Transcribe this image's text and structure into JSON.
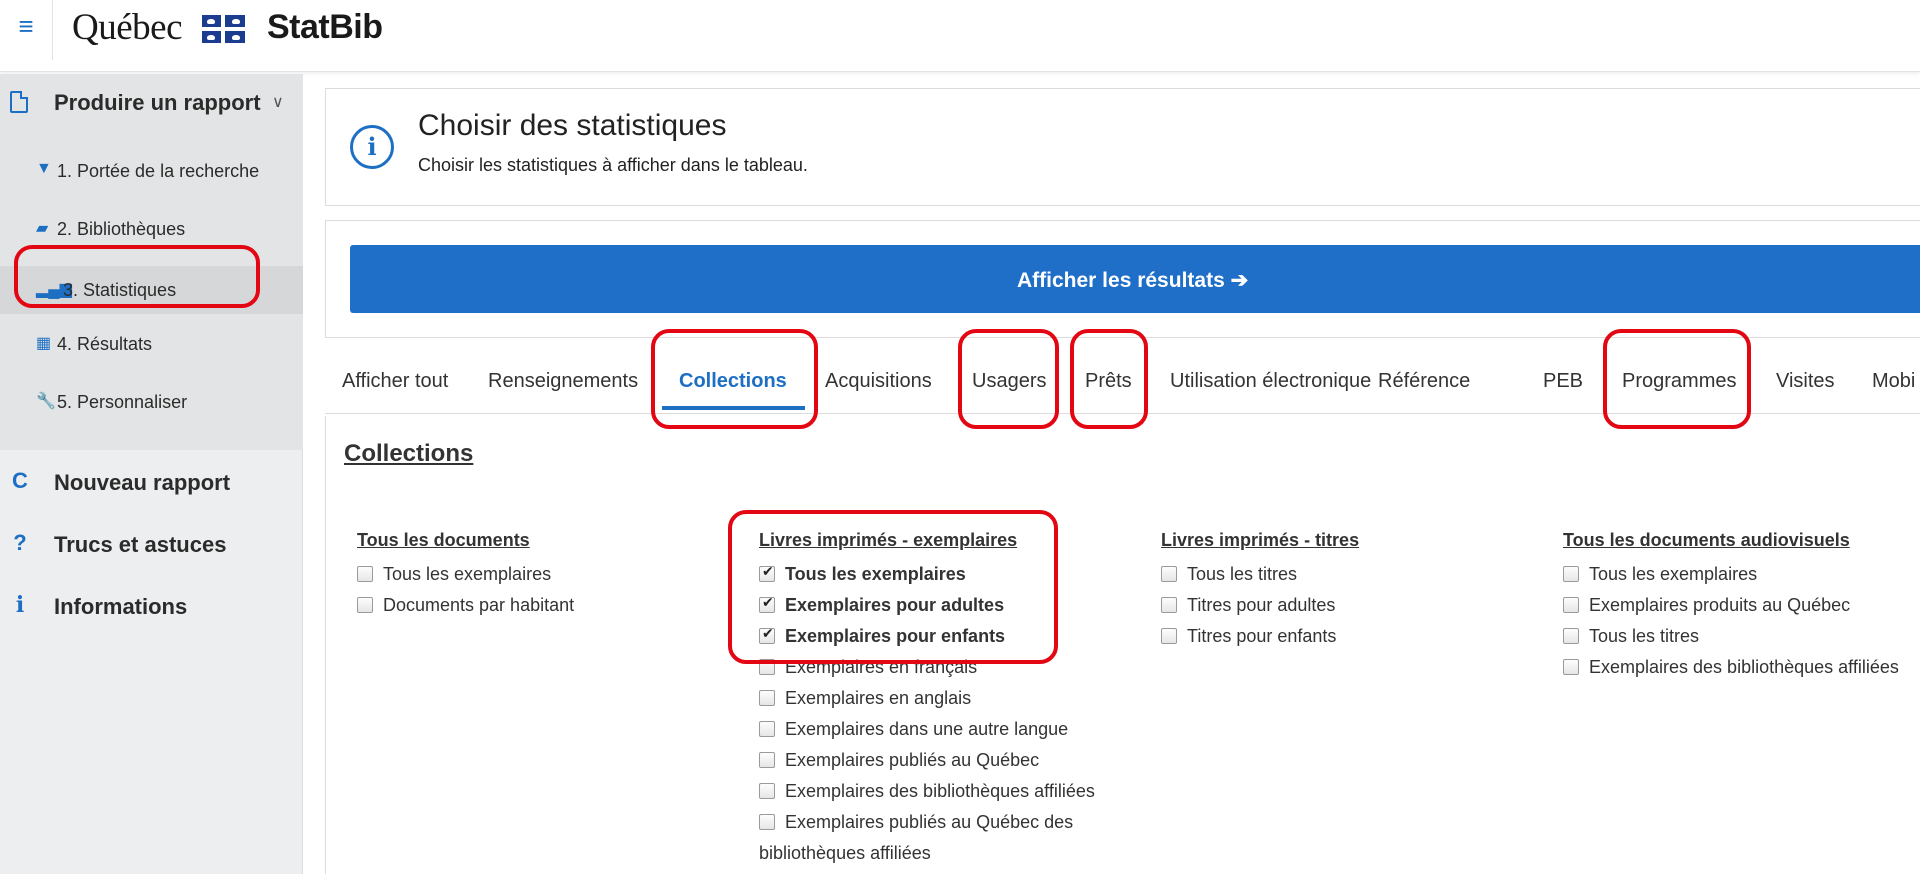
{
  "header": {
    "menu_icon": "hamburger-icon",
    "brand_quebec": "Québec",
    "brand_app": "StatBib"
  },
  "sidebar": {
    "section_label": "Produire un rapport",
    "steps": [
      {
        "label": "1. Portée de la recherche",
        "icon": "filter-icon"
      },
      {
        "label": "2. Bibliothèques",
        "icon": "book-icon"
      },
      {
        "label": "3. Statistiques",
        "icon": "bar-chart-icon"
      },
      {
        "label": "4. Résultats",
        "icon": "table-icon"
      },
      {
        "label": "5. Personnaliser",
        "icon": "wrench-icon"
      }
    ],
    "menu": [
      {
        "label": "Nouveau rapport",
        "icon": "refresh-icon"
      },
      {
        "label": "Trucs et astuces",
        "icon": "question-icon"
      },
      {
        "label": "Informations",
        "icon": "info-icon"
      }
    ]
  },
  "info": {
    "title": "Choisir des statistiques",
    "subtitle": "Choisir les statistiques à afficher dans le tableau."
  },
  "results_button": "Afficher les résultats ➔",
  "tabs": [
    "Afficher tout",
    "Renseignements",
    "Collections",
    "Acquisitions",
    "Usagers",
    "Prêts",
    "Utilisation électronique",
    "Référence",
    "PEB",
    "Programmes",
    "Visites",
    "Mobi"
  ],
  "active_tab": "Collections",
  "section_title": "Collections",
  "columns": [
    {
      "title": "Tous les documents",
      "items": [
        {
          "label": "Tous les exemplaires",
          "checked": false
        },
        {
          "label": "Documents par habitant",
          "checked": false
        }
      ]
    },
    {
      "title": "Livres imprimés - exemplaires",
      "items": [
        {
          "label": "Tous les exemplaires",
          "checked": true
        },
        {
          "label": "Exemplaires pour adultes",
          "checked": true
        },
        {
          "label": "Exemplaires pour enfants",
          "checked": true
        },
        {
          "label": "Exemplaires en français",
          "checked": false
        },
        {
          "label": "Exemplaires en anglais",
          "checked": false
        },
        {
          "label": "Exemplaires dans une autre langue",
          "checked": false
        },
        {
          "label": "Exemplaires publiés au Québec",
          "checked": false
        },
        {
          "label": "Exemplaires des bibliothèques affiliées",
          "checked": false
        },
        {
          "label": "Exemplaires publiés au Québec des",
          "label_2": "bibliothèques affiliées",
          "checked": false
        }
      ]
    },
    {
      "title": "Livres imprimés - titres",
      "items": [
        {
          "label": "Tous les titres",
          "checked": false
        },
        {
          "label": "Titres pour adultes",
          "checked": false
        },
        {
          "label": "Titres pour enfants",
          "checked": false
        }
      ]
    },
    {
      "title": "Tous les documents audiovisuels",
      "items": [
        {
          "label": "Tous les exemplaires",
          "checked": false
        },
        {
          "label": "Exemplaires produits au Québec",
          "checked": false
        },
        {
          "label": "Tous les titres",
          "checked": false
        },
        {
          "label": "Exemplaires des bibliothèques affiliées",
          "checked": false
        }
      ]
    }
  ],
  "colors": {
    "accent": "#1d6fc4",
    "button": "#1f6fc8",
    "highlight": "#e30613",
    "sidebar_bg": "#eceeef"
  }
}
